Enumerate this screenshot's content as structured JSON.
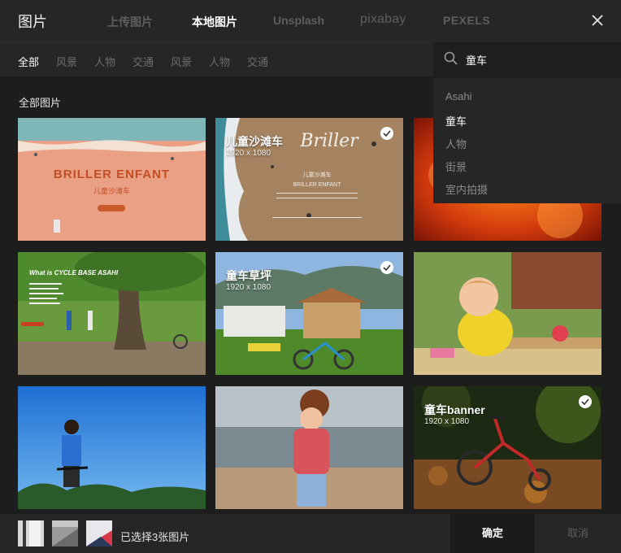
{
  "header": {
    "title": "图片",
    "tabs": [
      {
        "label": "上传图片"
      },
      {
        "label": "本地图片"
      },
      {
        "label": "Unsplash"
      },
      {
        "label": "pixabay"
      },
      {
        "label": "PEXELS"
      }
    ],
    "active_tab": "本地图片"
  },
  "filters": {
    "categories": [
      "全部",
      "风景",
      "人物",
      "交通",
      "风景",
      "人物",
      "交通"
    ],
    "active": "全部"
  },
  "search": {
    "value": "童车",
    "suggestions": [
      "Asahi",
      "童车",
      "人物",
      "街景",
      "室内拍摄"
    ],
    "highlighted": "童车"
  },
  "section_title": "全部图片",
  "images": [
    {
      "label": "",
      "size": "",
      "selected": false,
      "overlay_text": [
        "BRILLER ENFANT",
        "儿童沙滩车"
      ]
    },
    {
      "label": "儿童沙滩车",
      "size": "1920 x 1080",
      "selected": true,
      "overlay_text": [
        "Briller",
        "儿童沙滩车",
        "BRILLER ENFANT"
      ]
    },
    {
      "label": "",
      "size": "",
      "selected": false,
      "overlay_text": []
    },
    {
      "label": "",
      "size": "",
      "selected": false,
      "overlay_text": [
        "What is CYCLE BASE ASAHI"
      ]
    },
    {
      "label": "童车草坪",
      "size": "1920 x 1080",
      "selected": true,
      "overlay_text": []
    },
    {
      "label": "",
      "size": "",
      "selected": false,
      "overlay_text": []
    },
    {
      "label": "",
      "size": "",
      "selected": false,
      "overlay_text": []
    },
    {
      "label": "",
      "size": "",
      "selected": false,
      "overlay_text": []
    },
    {
      "label": "童车banner",
      "size": "1920 x 1080",
      "selected": true,
      "overlay_text": []
    }
  ],
  "footer": {
    "selected_text": "已选择3张图片",
    "confirm_label": "确定",
    "cancel_label": "取消"
  },
  "colors": {
    "background": "#1d1d1e",
    "panel": "#262627",
    "inactive_text": "#5e5e60",
    "active_text": "#ffffff"
  }
}
